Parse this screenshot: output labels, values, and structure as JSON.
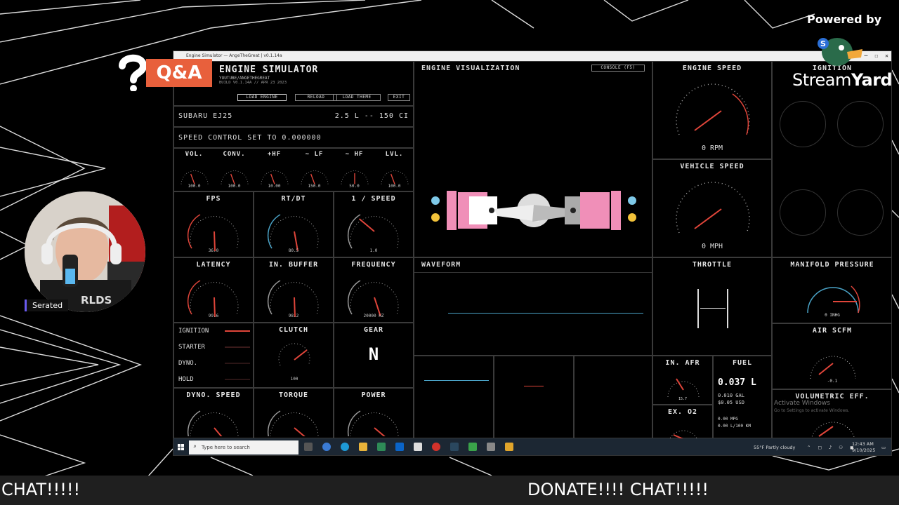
{
  "overlay": {
    "qa_label": "Q&A",
    "powered_by": "Powered by",
    "streamyard_regular": "Stream",
    "streamyard_bold": "Yard",
    "participant_name": "Serated",
    "ticker_left": "CHAT!!!!!",
    "ticker_right": "DONATE!!!! CHAT!!!!!"
  },
  "window": {
    "title": "Engine Simulator — AngeTheGreat | v0.1.14a"
  },
  "app": {
    "title": "ENGINE SIMULATOR",
    "subtitle1": "YOUTUBE/ANGETHEGREAT",
    "subtitle2": "BUILD V0.1.14A // APR 23 2023",
    "buttons": [
      "LOAD ENGINE",
      "RELOAD",
      "LOAD THEME",
      "EXIT"
    ],
    "engine_name": "SUBARU EJ25",
    "displacement": "2.5 L -- 150 CI",
    "speed_control": "SPEED CONTROL SET TO 0.000000",
    "small_gauges": [
      {
        "label": "VOL.",
        "value": "100.0"
      },
      {
        "label": "CONV.",
        "value": "100.0"
      },
      {
        "label": "+HF",
        "value": "10.00"
      },
      {
        "label": "~ LF",
        "value": "150.0"
      },
      {
        "label": "~ HF",
        "value": "50.0"
      },
      {
        "label": "LVL.",
        "value": "100.0"
      }
    ],
    "row_gauges": [
      {
        "label": "FPS",
        "value": "36.0"
      },
      {
        "label": "RT/DT",
        "value": "80.5"
      },
      {
        "label": "1 / SPEED",
        "value": "1.0"
      },
      {
        "label": "LATENCY",
        "value": "99.6"
      },
      {
        "label": "IN. BUFFER",
        "value": "98.2"
      },
      {
        "label": "FREQUENCY",
        "value": "20000 HZ"
      },
      {
        "label": "DYNO. SPEED",
        "value": ""
      },
      {
        "label": "TORQUE",
        "value": ""
      },
      {
        "label": "POWER",
        "value": ""
      }
    ],
    "indicators": [
      "IGNITION",
      "STARTER",
      "DYNO.",
      "HOLD"
    ],
    "clutch": {
      "label": "CLUTCH",
      "value": "100"
    },
    "gear": {
      "label": "GEAR",
      "value": "N"
    },
    "visualization": {
      "label": "ENGINE VISUALIZATION",
      "console_button": "CONSOLE (F5)"
    },
    "waveform_label": "WAVEFORM",
    "engine_speed": {
      "label": "ENGINE SPEED",
      "value": "0 RPM"
    },
    "vehicle_speed": {
      "label": "VEHICLE SPEED",
      "value": "0 MPH"
    },
    "ignition_label": "IGNITION",
    "throttle_label": "THROTTLE",
    "manifold": {
      "label": "MANIFOLD PRESSURE",
      "value": "0 INHG"
    },
    "air_scfm": {
      "label": "AIR SCFM",
      "value": "-0.1"
    },
    "vol_eff": {
      "label": "VOLUMETRIC EFF."
    },
    "in_afr": {
      "label": "IN. AFR",
      "value": "15.7"
    },
    "ex_o2": {
      "label": "EX. O2"
    },
    "fuel": {
      "label": "FUEL",
      "liters": "0.037 L",
      "gal": "0.010 GAL",
      "usd": "$0.05 USD",
      "mpg": "0.00 MPG",
      "l100": "0.00 L/100 KM"
    },
    "watermark1": "Activate Windows",
    "watermark2": "Go to Settings to activate Windows."
  },
  "taskbar": {
    "search_placeholder": "Type here to search",
    "weather": "55°F Partly cloudy",
    "time": "12:43 AM",
    "date": "9/10/2025"
  },
  "colors": {
    "needle": "#e0453a",
    "qa_orange": "#e8603c",
    "piston_pink": "#f08fb8",
    "taskbar": "#1c2733"
  }
}
